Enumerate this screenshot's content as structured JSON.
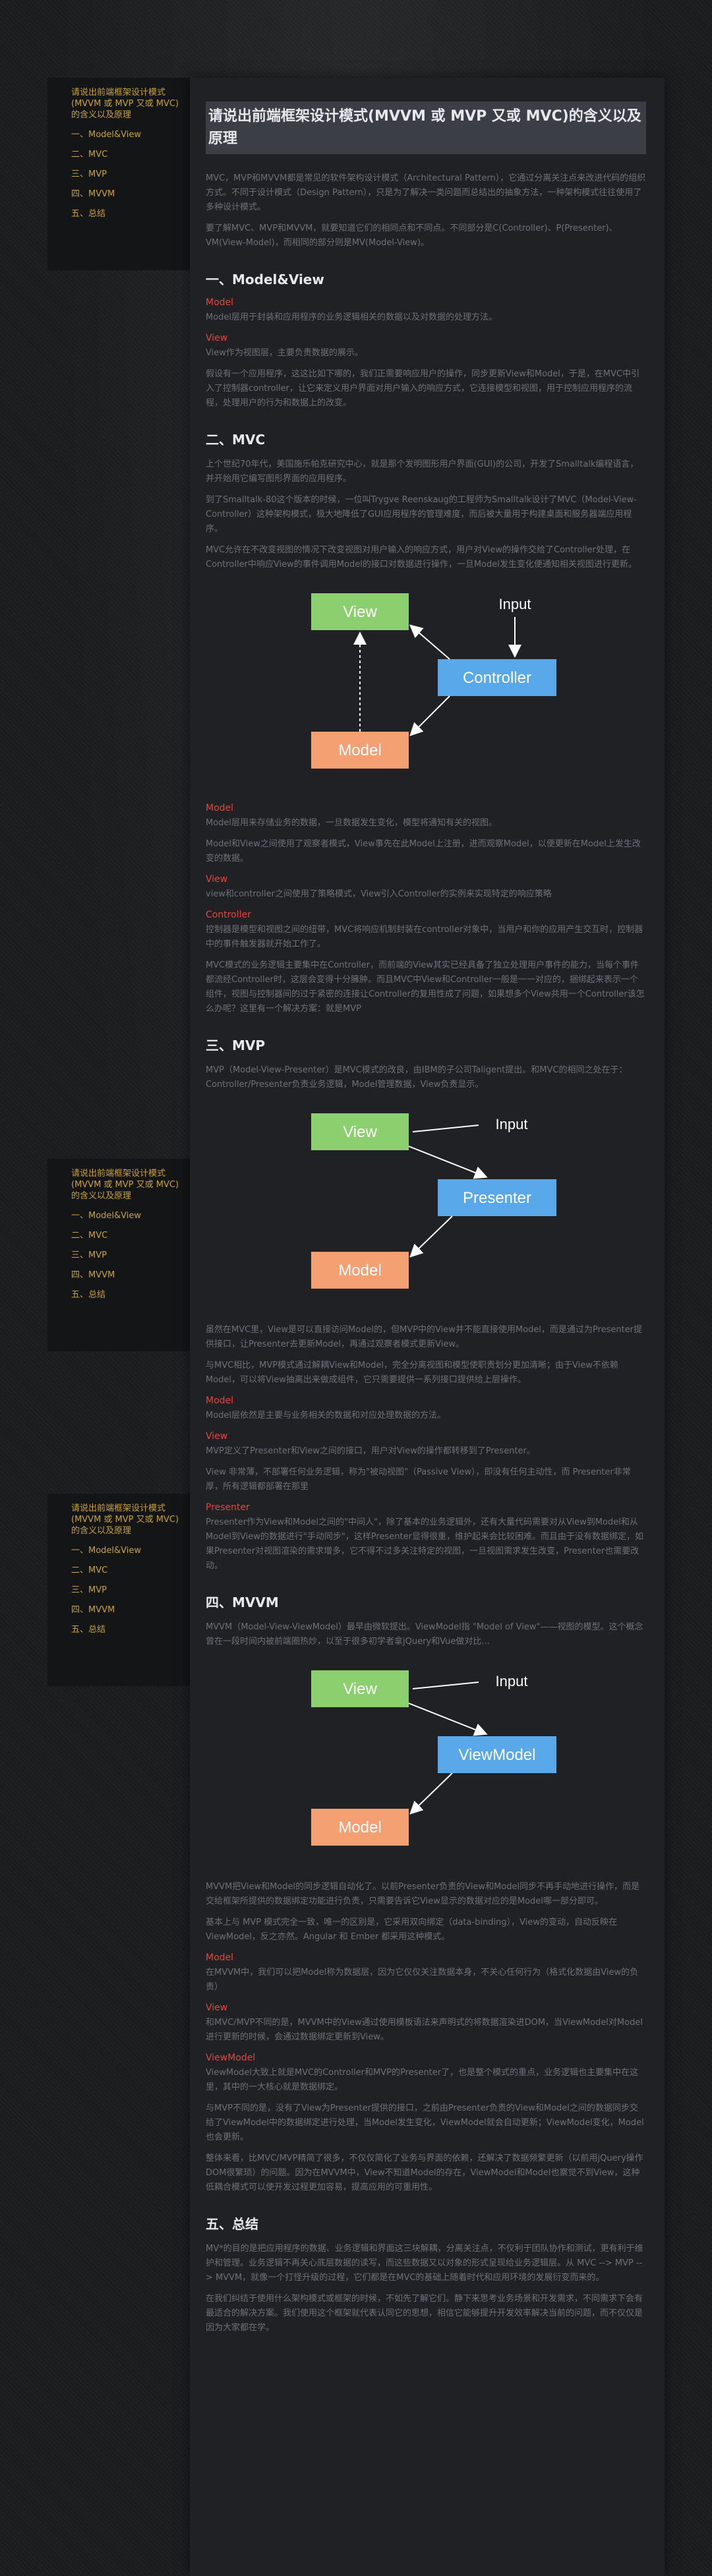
{
  "toc": {
    "title": "请说出前端框架设计模式(MVVM 或 MVP 又或 MVC)的含义以及原理",
    "items": [
      "一、Model&View",
      "二、MVC",
      "三、MVP",
      "四、MVVM",
      "五、总结"
    ]
  },
  "article": {
    "title": "请说出前端框架设计模式(MVVM 或 MVP 又或 MVC)的含义以及原理",
    "intro": [
      "MVC，MVP和MVVM都是常见的软件架构设计模式（Architectural Pattern），它通过分离关注点来改进代码的组织方式。不同于设计模式（Design Pattern），只是为了解决一类问题而总结出的抽象方法，一种架构模式往往使用了多种设计模式。",
      "要了解MVC、MVP和MVVM，就要知道它们的相同点和不同点。不同部分是C(Controller)、P(Presenter)、VM(View-Model)，而相同的部分则是MV(Model-View)。"
    ],
    "s1": {
      "heading": "一、Model&View",
      "model_label": "Model",
      "model_text": "Model层用于封装和应用程序的业务逻辑相关的数据以及对数据的处理方法。",
      "view_label": "View",
      "view_text": "View作为视图层，主要负责数据的展示。",
      "extra": "假设有一个应用程序，这这比如下哪的，我们正需要响应用户的操作，同步更新View和Model，于是，在MVC中引入了控制器controller，让它来定义用户界面对用户输入的响应方式，它连接模型和视图，用于控制应用程序的流程，处理用户的行为和数据上的改变。"
    },
    "s2": {
      "heading": "二、MVC",
      "p1": "上个世纪70年代，美国施乐帕克研究中心，就是那个发明图形用户界面(GUI)的公司，开发了Smalltalk编程语言，并开始用它编写图形界面的应用程序。",
      "p2": "到了Smalltalk-80这个版本的时候，一位叫Trygve Reenskaug的工程师为Smalltalk设计了MVC（Model-View-Controller）这种架构模式，极大地降低了GUI应用程序的管理难度，而后被大量用于构建桌面和服务器端应用程序。",
      "p3": "MVC允许在不改变视图的情况下改变视图对用户输入的响应方式，用户对View的操作交给了Controller处理，在Controller中响应View的事件调用Model的接口对数据进行操作，一旦Model发生变化便通知相关视图进行更新。",
      "model_label": "Model",
      "model_text1": "Model层用来存储业务的数据，一旦数据发生变化，模型将通知有关的视图。",
      "model_text2": "Model和View之间使用了观察者模式，View事先在此Model上注册，进而观察Model，以便更新在Model上发生改变的数据。",
      "view_label": "View",
      "view_text": "view和controller之间使用了策略模式，View引入Controller的实例来实现特定的响应策略",
      "controller_label": "Controller",
      "controller_text": "控制器是模型和视图之间的纽带，MVC将响应机制封装在controller对象中，当用户和你的应用产生交互时，控制器中的事件触发器就开始工作了。",
      "extra": "MVC模式的业务逻辑主要集中在Controller，而前端的View其实已经具备了独立处理用户事件的能力，当每个事件都流经Controller时，这层会变得十分臃肿。而且MVC中View和Controller一般是一一对应的，捆绑起来表示一个组件，视图与控制器间的过于紧密的连接让Controller的复用性成了问题，如果想多个View共用一个Controller该怎么办呢？这里有一个解决方案：就是MVP"
    },
    "s3": {
      "heading": "三、MVP",
      "p1": "MVP（Model-View-Presenter）是MVC模式的改良，由IBM的子公司Taligent提出。和MVC的相同之处在于：Controller/Presenter负责业务逻辑，Model管理数据，View负责显示。",
      "p2": "虽然在MVC里，View是可以直接访问Model的，但MVP中的View并不能直接使用Model，而是通过为Presenter提供接口，让Presenter去更新Model，再通过观察者模式更新View。",
      "p3": "与MVC相比，MVP模式通过解耦View和Model，完全分离视图和模型使职责划分更加清晰；由于View不依赖Model，可以将View抽离出来做成组件，它只需要提供一系列接口提供给上层操作。",
      "model_label": "Model",
      "model_text": "Model层依然是主要与业务相关的数据和对应处理数据的方法。",
      "view_label": "View",
      "view_text1": "MVP定义了Presenter和View之间的接口，用户对View的操作都转移到了Presenter。",
      "view_text2": "View 非常薄，不部署任何业务逻辑，称为\"被动视图\"（Passive View），即没有任何主动性，而 Presenter非常厚，所有逻辑都部署在那里",
      "presenter_label": "Presenter",
      "presenter_text": "Presenter作为View和Model之间的\"中间人\"，除了基本的业务逻辑外，还有大量代码需要对从View到Model和从Model到View的数据进行\"手动同步\"，这样Presenter显得很重，维护起来会比较困难。而且由于没有数据绑定，如果Presenter对视图渲染的需求增多，它不得不过多关注特定的视图，一旦视图需求发生改变，Presenter也需要改动。"
    },
    "s4": {
      "heading": "四、MVVM",
      "p1": "MVVM（Model-View-ViewModel）最早由微软提出。ViewModel指 \"Model of View\"——视图的模型。这个概念曾在一段时间内被前端圈热炒，以至于很多初学者拿jQuery和Vue做对比...",
      "p2": "MVVM把View和Model的同步逻辑自动化了。以前Presenter负责的View和Model同步不再手动地进行操作，而是交给框架所提供的数据绑定功能进行负责，只需要告诉它View显示的数据对应的是Model哪一部分即可。",
      "p3": "基本上与 MVP 模式完全一致，唯一的区别是，它采用双向绑定（data-binding），View的变动，自动反映在 ViewModel，反之亦然。Angular 和 Ember 都采用这种模式。",
      "model_label": "Model",
      "model_text": "在MVVM中，我们可以把Model称为数据层，因为它仅仅关注数据本身，不关心任何行为（格式化数据由View的负责）",
      "view_label": "View",
      "view_text": "和MVC/MVP不同的是，MVVM中的View通过使用模板语法来声明式的将数据渲染进DOM，当ViewModel对Model进行更新的时候，会通过数据绑定更新到View。",
      "vm_label": "ViewModel",
      "vm_text1": "ViewModel大致上就是MVC的Controller和MVP的Presenter了，也是整个模式的重点，业务逻辑也主要集中在这里，其中的一大核心就是数据绑定。",
      "vm_text2": "与MVP不同的是，没有了View为Presenter提供的接口，之前由Presenter负责的View和Model之间的数据同步交给了ViewModel中的数据绑定进行处理，当Model发生变化，ViewModel就会自动更新；ViewModel变化，Model也会更新。",
      "extra": "整体来看，比MVC/MVP精简了很多，不仅仅简化了业务与界面的依赖，还解决了数据频繁更新（以前用jQuery操作DOM很繁琐）的问题。因为在MVVM中，View不知道Model的存在，ViewModel和Model也察觉不到View，这种低耦合模式可以使开发过程更加容易，提高应用的可重用性。"
    },
    "s5": {
      "heading": "五、总结",
      "p1": "MV*的目的是把应用程序的数据、业务逻辑和界面这三块解耦，分离关注点，不仅利于团队协作和测试，更有利于维护和管理。业务逻辑不再关心底层数据的读写，而这些数据又以对象的形式呈现给业务逻辑层。从 MVC --> MVP --> MVVM，就像一个打怪升级的过程，它们都是在MVC的基础上随着时代和应用环境的发展衍变而来的。",
      "p2": "在我们纠结于使用什么架构模式或框架的时候，不如先了解它们。静下来思考业务场景和开发需求，不同需求下会有最适合的解决方案。我们使用这个框架就代表认同它的思想，相信它能够提升开发效率解决当前的问题，而不仅仅是因为大家都在学。"
    },
    "diagrams": {
      "mvc": {
        "view": "View",
        "input": "Input",
        "center": "Controller",
        "model": "Model"
      },
      "mvp": {
        "view": "View",
        "input": "Input",
        "center": "Presenter",
        "model": "Model"
      },
      "mvvm": {
        "view": "View",
        "input": "Input",
        "center": "ViewModel",
        "model": "Model"
      }
    },
    "colors": {
      "green": "#8ccf6e",
      "blue": "#59a9ea",
      "orange": "#f4a072",
      "accent": "#e8453c",
      "toc": "#c9a13d"
    }
  }
}
